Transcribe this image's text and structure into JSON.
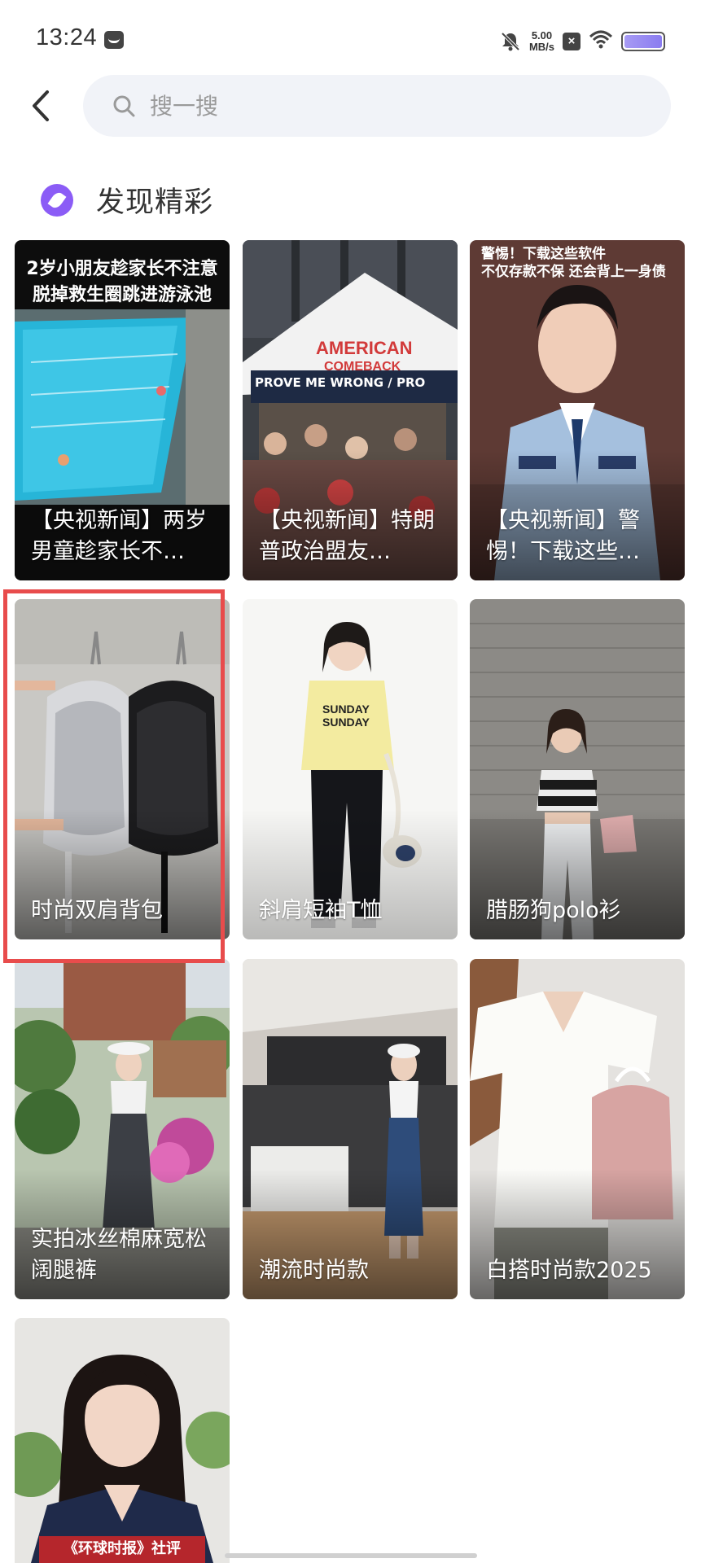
{
  "status_bar": {
    "time": "13:24",
    "speed_value": "5.00",
    "speed_unit": "MB/s",
    "x_badge": "×",
    "icons": [
      "message-icon",
      "mute-icon",
      "wifi-icon",
      "battery-icon"
    ]
  },
  "search": {
    "placeholder": "搜一搜",
    "back_icon": "chevron-left-icon",
    "search_icon": "search-icon"
  },
  "section": {
    "title": "发现精彩",
    "icon": "discover-icon"
  },
  "cards": [
    {
      "title": "【央视新闻】两岁男童趁家长不…",
      "overlay": "2岁小朋友趁家长不注意\n脱掉救生圈跳进游泳池"
    },
    {
      "title": "【央视新闻】特朗普政治盟友…",
      "overlay": "PROVE ME WRONG / PRO"
    },
    {
      "title": "【央视新闻】警惕！下载这些…",
      "overlay": "警惕！下载这些软件\n不仅存款不保 还会背上一身债"
    },
    {
      "title": "时尚双肩背包"
    },
    {
      "title": "斜肩短袖T恤"
    },
    {
      "title": "腊肠狗polo衫"
    },
    {
      "title": "实拍冰丝棉麻宽松阔腿裤"
    },
    {
      "title": "潮流时尚款"
    },
    {
      "title": "白搭时尚款2025"
    },
    {
      "title": "",
      "overlay": "《环球时报》社评"
    }
  ],
  "colors": {
    "accent": "#8b5cf6",
    "highlight": "#e84c4c",
    "search_bg": "#f1f3f8"
  }
}
